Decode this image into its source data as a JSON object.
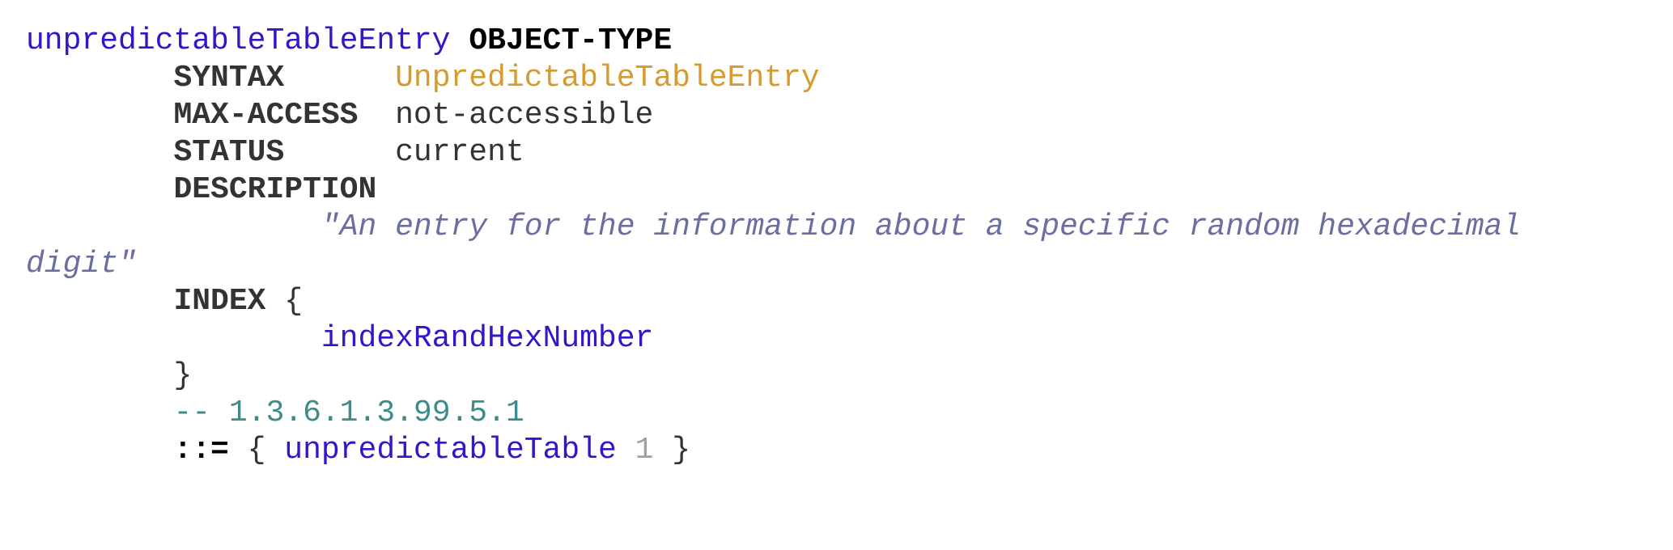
{
  "object_name": "unpredictableTableEntry",
  "object_type_kw": "OBJECT-TYPE",
  "syntax_kw": "SYNTAX",
  "syntax_value": "UnpredictableTableEntry",
  "max_access_kw": "MAX-ACCESS",
  "max_access_value": "not-accessible",
  "status_kw": "STATUS",
  "status_value": "current",
  "description_kw": "DESCRIPTION",
  "description_line1": "\"An entry for the information about a specific random hexadecimal",
  "description_line2": "digit\"",
  "index_kw": "INDEX",
  "index_open": "{",
  "index_item": "indexRandHexNumber",
  "index_close": "}",
  "oid_comment": "-- 1.3.6.1.3.99.5.1",
  "assign_op": "::=",
  "assign_open": "{",
  "parent_name": "unpredictableTable",
  "sub_id": "1",
  "assign_close": "}"
}
